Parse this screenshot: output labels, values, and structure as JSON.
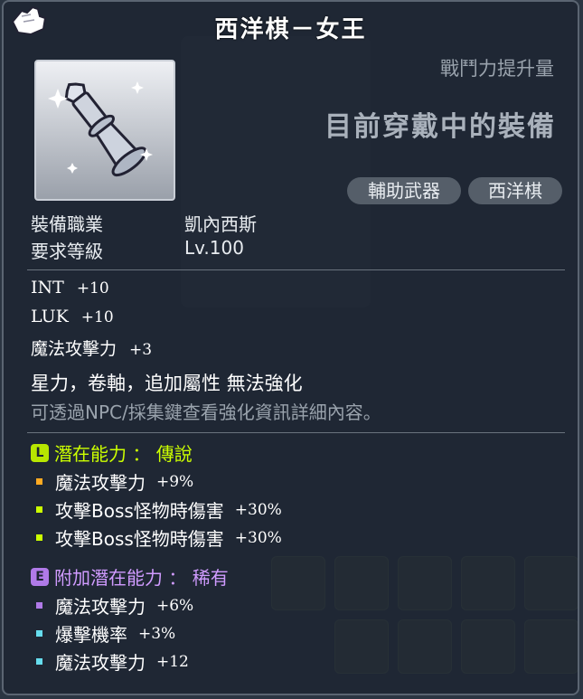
{
  "item": {
    "title": "西洋棋－女王",
    "power_label": "戰鬥力提升量",
    "equipped_label": "目前穿戴中的裝備",
    "tags": [
      "輔助武器",
      "西洋棋"
    ]
  },
  "requirements": [
    {
      "label": "裝備職業",
      "value": "凱內西斯"
    },
    {
      "label": "要求等級",
      "value": "Lv.100"
    }
  ],
  "stats": [
    {
      "name": "INT",
      "value": "+10"
    },
    {
      "name": "LUK",
      "value": "+10"
    },
    {
      "name": "魔法攻擊力",
      "value": "+3"
    }
  ],
  "notes": {
    "enhance": "星力，卷軸，追加屬性 無法強化",
    "hint": "可透過NPC/採集鍵查看強化資訊詳細內容。"
  },
  "potential": {
    "badge": "L",
    "header": "潛在能力 ： 傳說",
    "lines": [
      {
        "name": "魔法攻擊力",
        "value": "+9%",
        "dot_color": "#ffaa22"
      },
      {
        "name": "攻擊Boss怪物時傷害",
        "value": "+30%",
        "dot_color": "#ccff00"
      },
      {
        "name": "攻擊Boss怪物時傷害",
        "value": "+30%",
        "dot_color": "#ccff00"
      }
    ]
  },
  "additional_potential": {
    "badge": "E",
    "header": "附加潛在能力 ： 稀有",
    "lines": [
      {
        "name": "魔法攻擊力",
        "value": "+6%",
        "dot_color": "#b07ae8"
      },
      {
        "name": "爆擊機率",
        "value": "+3%",
        "dot_color": "#66ddee"
      },
      {
        "name": "魔法攻擊力",
        "value": "+12",
        "dot_color": "#66ddee"
      }
    ]
  }
}
